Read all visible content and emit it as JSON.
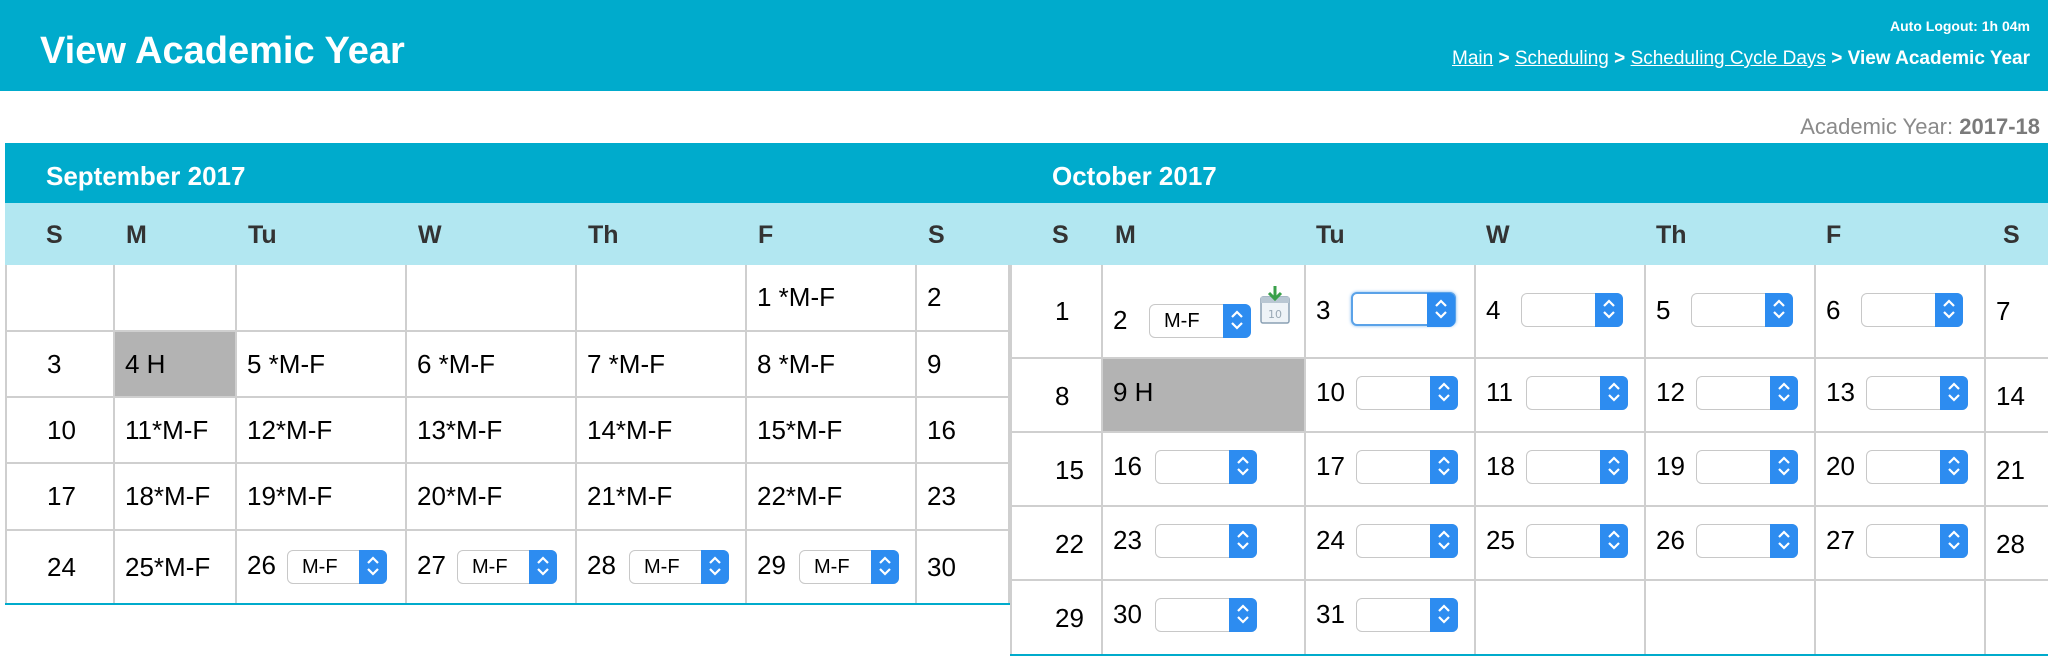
{
  "header": {
    "title": "View Academic Year",
    "auto_logout": "Auto Logout: 1h 04m",
    "breadcrumb": {
      "main": "Main",
      "scheduling": "Scheduling",
      "cycle_days": "Scheduling Cycle Days",
      "current": "View Academic Year",
      "separator": ">"
    }
  },
  "academic_year": {
    "label": "Academic Year:",
    "value": "2017-18"
  },
  "weekdays": [
    "S",
    "M",
    "Tu",
    "W",
    "Th",
    "F",
    "S"
  ],
  "september": {
    "title": "September 2017",
    "selects": {
      "s26": "M-F",
      "s27": "M-F",
      "s28": "M-F",
      "s29": "M-F"
    },
    "cells": {
      "d1": "1 *M-F",
      "d2": "2",
      "d3": "3",
      "d4": "4 H",
      "d5": "5 *M-F",
      "d6": "6 *M-F",
      "d7": "7 *M-F",
      "d8": "8 *M-F",
      "d9": "9",
      "d10": "10",
      "d11": "11*M-F",
      "d12": "12*M-F",
      "d13": "13*M-F",
      "d14": "14*M-F",
      "d15": "15*M-F",
      "d16": "16",
      "d17": "17",
      "d18": "18*M-F",
      "d19": "19*M-F",
      "d20": "20*M-F",
      "d21": "21*M-F",
      "d22": "22*M-F",
      "d23": "23",
      "d24": "24",
      "d25": "25*M-F",
      "d26": "26",
      "d27": "27",
      "d28": "28",
      "d29": "29",
      "d30": "30"
    }
  },
  "october": {
    "title": "October 2017",
    "selects": {
      "s2": "M-F"
    },
    "cells": {
      "d1": "1",
      "d2": "2",
      "d3": "3",
      "d4": "4",
      "d5": "5",
      "d6": "6",
      "d7": "7",
      "d8": "8",
      "d9": "9 H",
      "d10": "10",
      "d11": "11",
      "d12": "12",
      "d13": "13",
      "d14": "14",
      "d15": "15",
      "d16": "16",
      "d17": "17",
      "d18": "18",
      "d19": "19",
      "d20": "20",
      "d21": "21",
      "d22": "22",
      "d23": "23",
      "d24": "24",
      "d25": "25",
      "d26": "26",
      "d27": "27",
      "d28": "28",
      "d29": "29",
      "d30": "30",
      "d31": "31"
    }
  },
  "icons": {
    "arrow": "chevron-up-down-icon",
    "calendar": "calendar-download-icon"
  },
  "colors": {
    "accent": "#00abcc",
    "weekday_bg": "#b2e7f1",
    "holiday_bg": "#b3b3b3",
    "select_arrow": "#2d8cf0"
  }
}
